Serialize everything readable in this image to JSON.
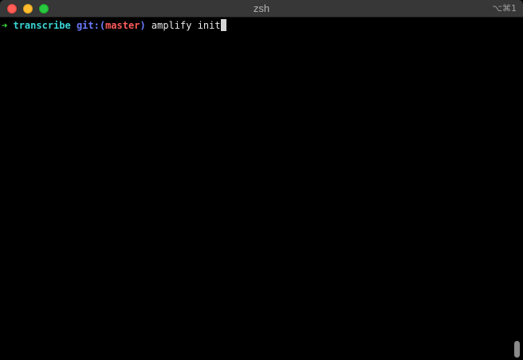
{
  "window": {
    "title": "zsh",
    "shortcut": "⌥⌘1"
  },
  "terminal": {
    "prompt_arrow": "➜",
    "directory": "transcribe",
    "git_prefix": "git:(",
    "git_branch": "master",
    "git_suffix": ")",
    "command": "amplify init"
  },
  "colors": {
    "arrow": "#3ee03e",
    "directory": "#38d6d6",
    "git_label": "#6c7cff",
    "git_branch": "#ff5a5a",
    "background": "#000000"
  },
  "icons": {
    "close": "close-button-icon",
    "minimize": "minimize-button-icon",
    "zoom": "zoom-button-icon"
  }
}
